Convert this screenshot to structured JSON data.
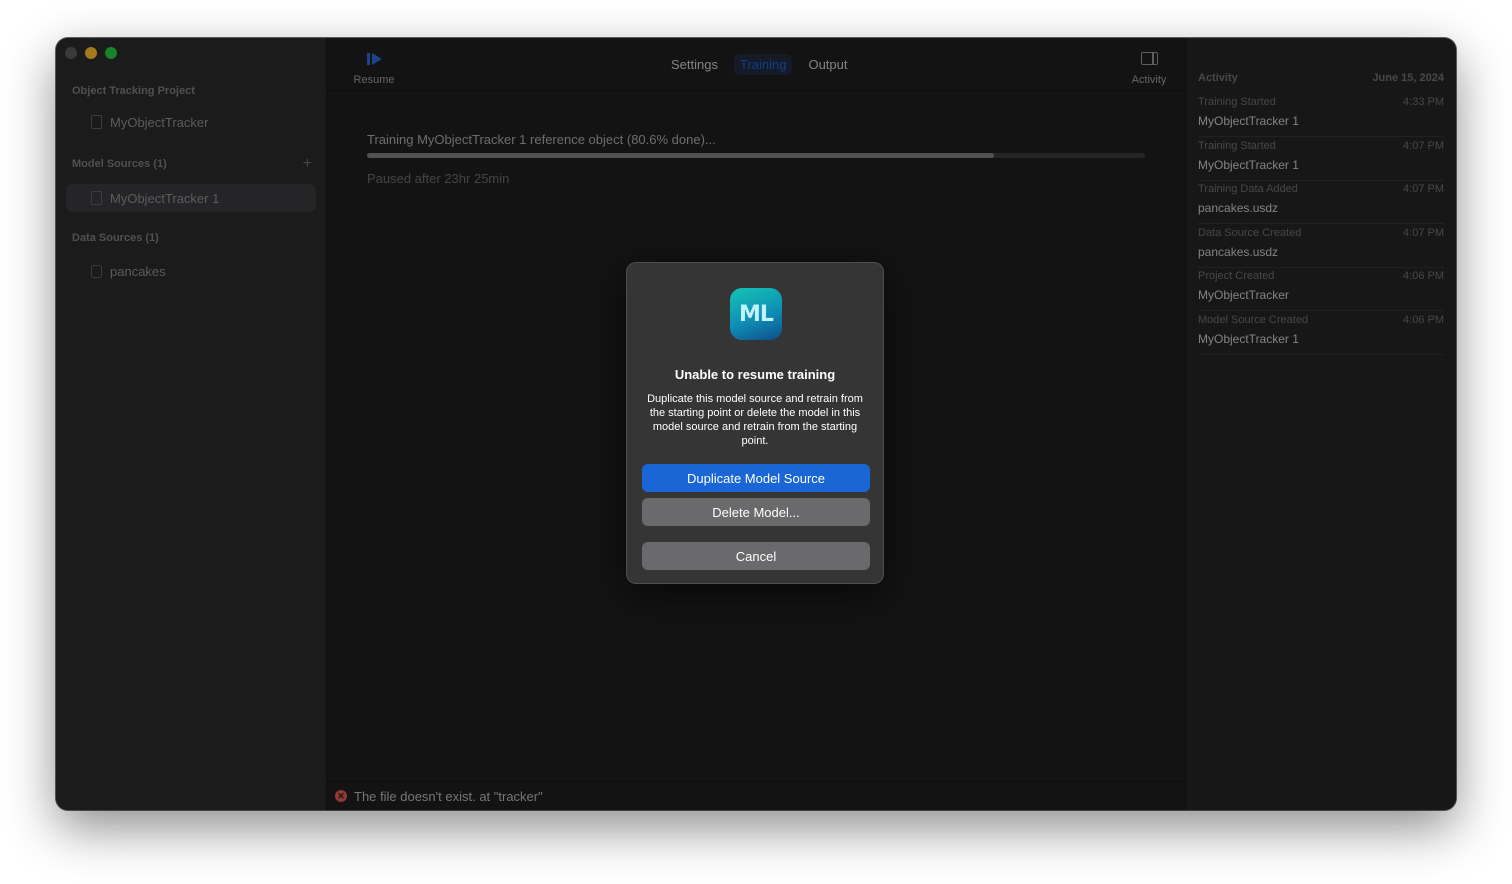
{
  "sidebar": {
    "project_section": "Object Tracking Project",
    "project_item": "MyObjectTracker",
    "model_sources_section": "Model Sources (1)",
    "model_source_item": "MyObjectTracker 1",
    "data_sources_section": "Data Sources (1)",
    "data_source_item": "pancakes",
    "add_icon": "plus-icon"
  },
  "toolbar": {
    "resume_label": "Resume",
    "tabs": [
      "Settings",
      "Training",
      "Output"
    ],
    "active_tab": "Training",
    "activity_label": "Activity"
  },
  "training": {
    "status_text": "Training MyObjectTracker 1 reference object (80.6% done)...",
    "progress_percent": 80.6,
    "paused_text": "Paused after 23hr 25min"
  },
  "statusbar": {
    "error_text": "The file doesn't exist. at \"tracker\""
  },
  "activity": {
    "header": "Activity",
    "date": "June 15, 2024",
    "items": [
      {
        "kind": "Training Started",
        "time": "4:33 PM",
        "name": "MyObjectTracker 1"
      },
      {
        "kind": "Training Started",
        "time": "4:07 PM",
        "name": "MyObjectTracker 1"
      },
      {
        "kind": "Training Data Added",
        "time": "4:07 PM",
        "name": "pancakes.usdz"
      },
      {
        "kind": "Data Source Created",
        "time": "4:07 PM",
        "name": "pancakes.usdz"
      },
      {
        "kind": "Project Created",
        "time": "4:06 PM",
        "name": "MyObjectTracker"
      },
      {
        "kind": "Model Source Created",
        "time": "4:06 PM",
        "name": "MyObjectTracker 1"
      }
    ]
  },
  "dialog": {
    "icon_text": "ML",
    "title": "Unable to resume training",
    "message": "Duplicate this model source and retrain from the starting point or delete the model in this model source and retrain from the starting point.",
    "primary_button": "Duplicate Model Source",
    "secondary_button": "Delete Model...",
    "cancel_button": "Cancel"
  },
  "colors": {
    "accent": "#1a66d6",
    "close_dot": "#5a5a5b",
    "minimize_dot": "#febc2e",
    "maximize_dot": "#28c840",
    "error": "#e05a52"
  }
}
